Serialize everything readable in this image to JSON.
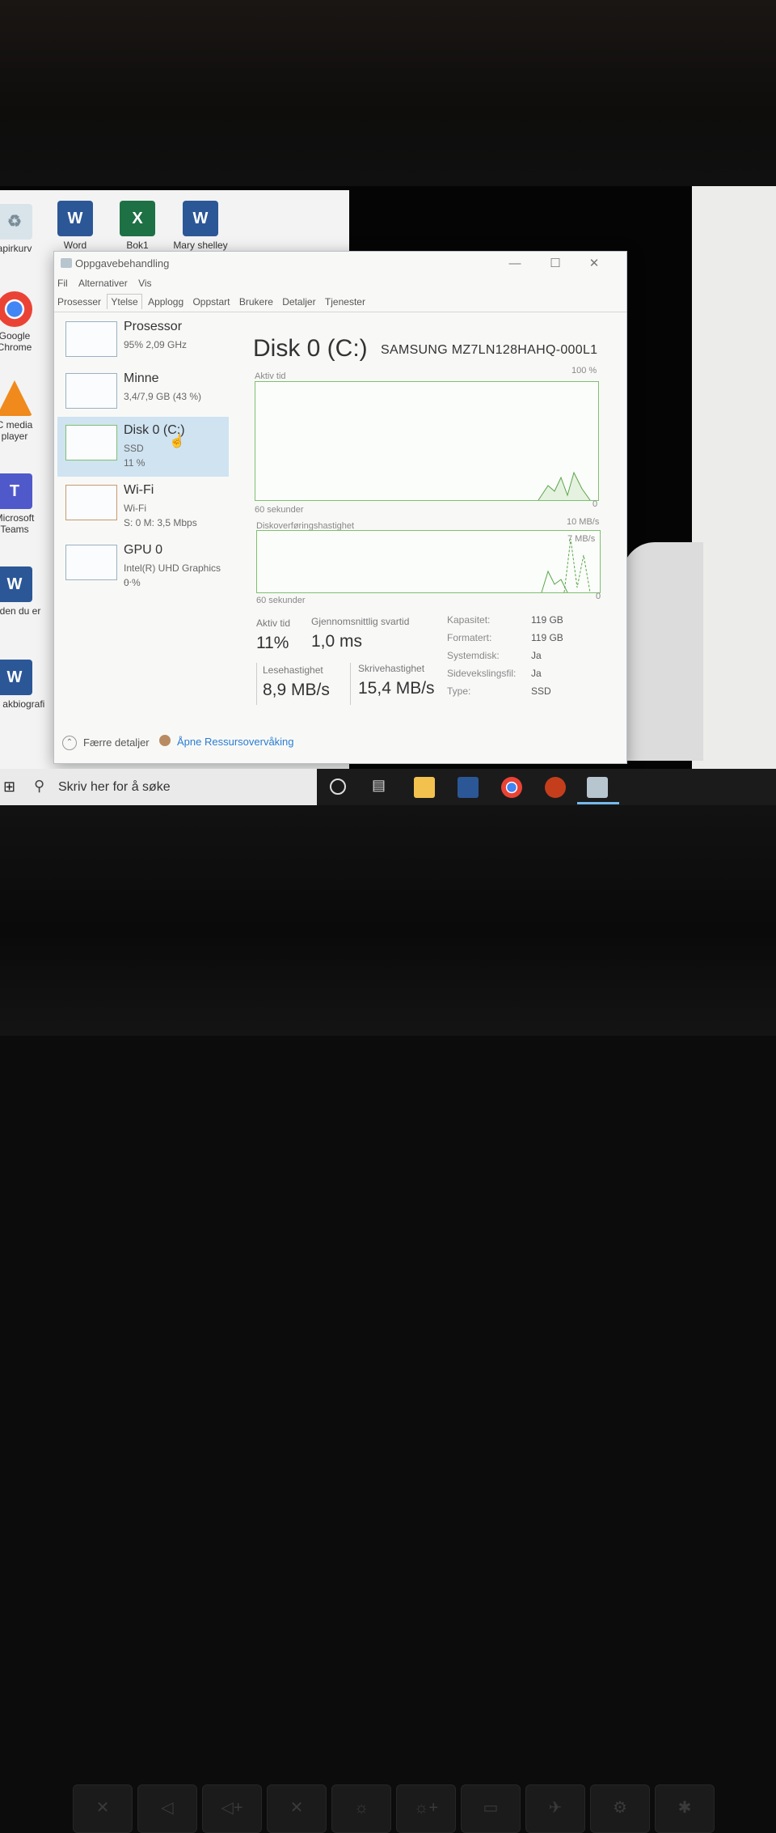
{
  "desktop_icons": [
    {
      "label": "apirkurv",
      "icon": "recycle-bin-icon"
    },
    {
      "label": "Word",
      "icon": "word-icon"
    },
    {
      "label": "Bok1",
      "icon": "excel-icon"
    },
    {
      "label": "Mary shelley",
      "icon": "word-doc-icon"
    },
    {
      "label": "Google Chrome",
      "icon": "chrome-icon"
    },
    {
      "label": "C media player",
      "icon": "vlc-icon"
    },
    {
      "label": "Microsoft Teams",
      "icon": "teams-icon"
    },
    {
      "label": "er den du er",
      "icon": "word-doc-icon"
    },
    {
      "label": "Min akbiografi",
      "icon": "word-doc-icon"
    }
  ],
  "window": {
    "title": "Oppgavebehandling",
    "menu": [
      "Fil",
      "Alternativer",
      "Vis"
    ],
    "tabs": [
      "Prosesser",
      "Ytelse",
      "Applogg",
      "Oppstart",
      "Brukere",
      "Detaljer",
      "Tjenester"
    ],
    "active_tab": "Ytelse"
  },
  "sidebar": [
    {
      "name": "Prosessor",
      "sub": "95% 2,09 GHz"
    },
    {
      "name": "Minne",
      "sub": "3,4/7,9 GB (43 %)"
    },
    {
      "name": "Disk 0 (C:)",
      "sub": "SSD",
      "sub2": "11 %",
      "selected": true
    },
    {
      "name": "Wi-Fi",
      "sub": "Wi-Fi",
      "sub2": "S: 0 M: 3,5 Mbps"
    },
    {
      "name": "GPU 0",
      "sub": "Intel(R) UHD Graphics ...",
      "sub2": "0 %"
    }
  ],
  "main": {
    "title": "Disk 0 (C:)",
    "model": "SAMSUNG MZ7LN128HAHQ-000L1",
    "graph1": {
      "label": "Aktiv tid",
      "max": "100 %",
      "time": "60 sekunder",
      "min": "0"
    },
    "graph2": {
      "label": "Diskoverføringshastighet",
      "max": "10 MB/s",
      "mid": "7 MB/s",
      "time": "60 sekunder",
      "min": "0"
    },
    "stats": {
      "active_label": "Aktiv tid",
      "active_value": "11%",
      "resp_label": "Gjennomsnittlig svartid",
      "resp_value": "1,0 ms",
      "read_label": "Lesehastighet",
      "read_value": "8,9 MB/s",
      "write_label": "Skrivehastighet",
      "write_value": "15,4 MB/s"
    },
    "info": [
      {
        "label": "Kapasitet:",
        "value": "119 GB"
      },
      {
        "label": "Formatert:",
        "value": "119 GB"
      },
      {
        "label": "Systemdisk:",
        "value": "Ja"
      },
      {
        "label": "Sidevekslingsfil:",
        "value": "Ja"
      },
      {
        "label": "Type:",
        "value": "SSD"
      }
    ]
  },
  "footer": {
    "fewer": "Færre detaljer",
    "monitor": "Åpne Ressursovervåking"
  },
  "taskbar": {
    "search_placeholder": "Skriv her for å søke"
  },
  "colors": {
    "graph_line": "#5aa54a",
    "selected_bg": "#cfe3f1",
    "accent": "#2b7cd3"
  }
}
